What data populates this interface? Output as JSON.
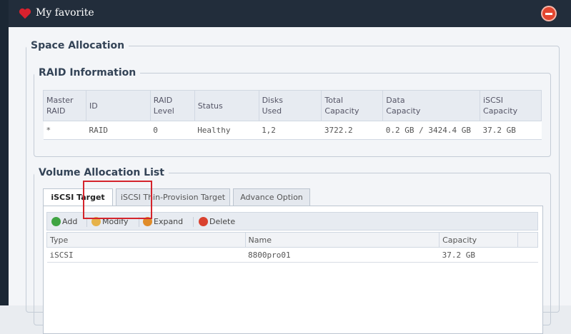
{
  "window": {
    "title": "My favorite",
    "icon": "heart-icon",
    "close_icon": "close-icon"
  },
  "space_allocation": {
    "legend": "Space Allocation",
    "raid_information": {
      "legend": "RAID Information",
      "columns": [
        [
          "Master",
          "RAID"
        ],
        [
          "ID"
        ],
        [
          "RAID",
          "Level"
        ],
        [
          "Status"
        ],
        [
          "Disks",
          "Used"
        ],
        [
          "Total",
          "Capacity"
        ],
        [
          "Data",
          "Capacity"
        ],
        [
          "iSCSI",
          "Capacity"
        ]
      ],
      "rows": [
        [
          "*",
          "RAID",
          "0",
          "Healthy",
          "1,2",
          "3722.2",
          "0.2 GB / 3424.4 GB",
          "37.2 GB"
        ]
      ]
    },
    "volume_allocation_list": {
      "legend": "Volume Allocation List",
      "tabs": [
        {
          "label": "iSCSI Target",
          "active": true
        },
        {
          "label": "iSCSI Thin-Provision Target",
          "active": false
        },
        {
          "label": "Advance Option",
          "active": false
        }
      ],
      "toolbar": {
        "add": {
          "label": "Add",
          "icon": "add-icon"
        },
        "modify": {
          "label": "Modify",
          "icon": "modify-icon"
        },
        "expand": {
          "label": "Expand",
          "icon": "expand-icon"
        },
        "delete": {
          "label": "Delete",
          "icon": "delete-icon"
        }
      },
      "columns": [
        "Type",
        "Name",
        "Capacity"
      ],
      "rows": [
        [
          "iSCSI",
          "8800pro01",
          "37.2 GB"
        ]
      ]
    }
  },
  "colors": {
    "titlebar": "#222d3b",
    "highlight": "#d4242c",
    "add": "#3fa442",
    "modify": "#e6b24a",
    "expand": "#e08c2a",
    "delete": "#d9412f"
  }
}
